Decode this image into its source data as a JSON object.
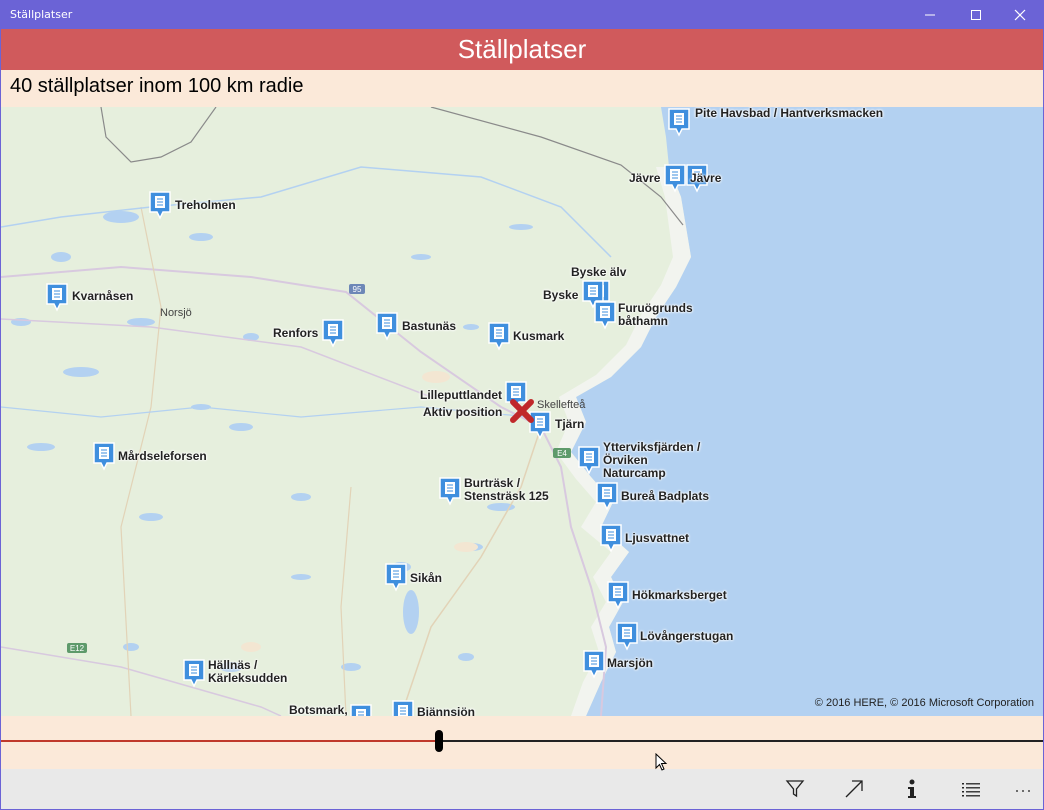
{
  "window": {
    "title": "Ställplatser"
  },
  "header": {
    "title": "Ställplatser"
  },
  "subheader": {
    "text": "40 ställplatser inom 100 km radie"
  },
  "map": {
    "copyright": "© 2016 HERE, © 2016 Microsoft Corporation",
    "towns": [
      "Norsjö",
      "Skellefteå"
    ],
    "road_badges": [
      "95",
      "E4",
      "E12"
    ],
    "current_position_label": "Aktiv position",
    "places": [
      {
        "label": "Pite Havsbad / Hantverksmacken"
      },
      {
        "label": "Jävre"
      },
      {
        "label": "Jävre"
      },
      {
        "label": "Treholmen"
      },
      {
        "label": "Kvarnåsen"
      },
      {
        "label": "Byske älv"
      },
      {
        "label": "Byske"
      },
      {
        "label": "Furuögrunds båthamn"
      },
      {
        "label": "Renfors"
      },
      {
        "label": "Bastunäs"
      },
      {
        "label": "Kusmark"
      },
      {
        "label": "Lilleputtlandet"
      },
      {
        "label": "Tjärn"
      },
      {
        "label": "Mårdseleforsen"
      },
      {
        "label": "Ytterviksfjärden / Örviken Naturcamp"
      },
      {
        "label": "Burträsk / Stensträsk 125"
      },
      {
        "label": "Bureå Badplats"
      },
      {
        "label": "Ljusvattnet"
      },
      {
        "label": "Sikån"
      },
      {
        "label": "Hökmarksberget"
      },
      {
        "label": "Lövångerstugan"
      },
      {
        "label": "Marsjön"
      },
      {
        "label": "Hällnäs / Kärleksudden"
      },
      {
        "label": "Botsmark,"
      },
      {
        "label": "Bjännsjön"
      }
    ]
  },
  "radius_slider": {
    "value_fraction": 0.42
  },
  "command_bar": {
    "buttons": [
      "filter-icon",
      "direction-arrow-icon",
      "info-icon",
      "list-icon",
      "more-icon"
    ]
  },
  "colors": {
    "titlebar": "#6b63d6",
    "header": "#d05a5c",
    "panel": "#fbe9d9",
    "water": "#b3d1f1",
    "land": "#e6efdd",
    "pin": "#3f8fde",
    "marker": "#c0282a"
  }
}
